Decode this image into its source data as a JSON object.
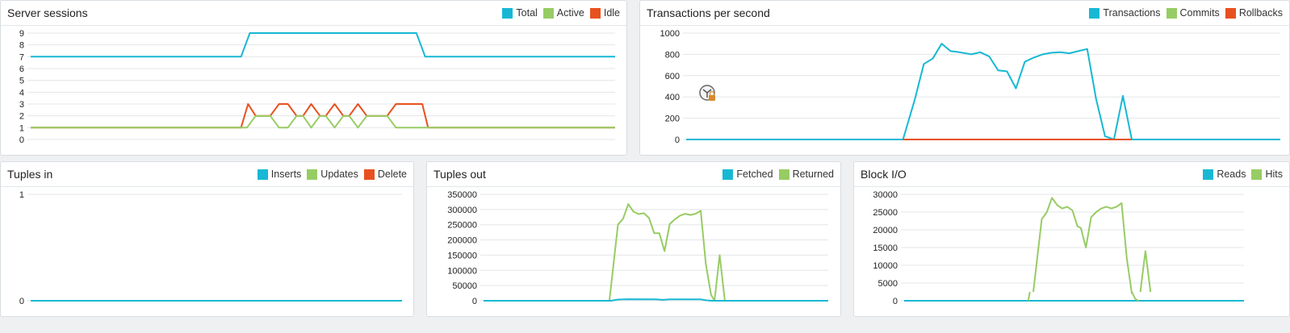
{
  "colors": {
    "cyan": "#17b8d4",
    "green": "#97cc64",
    "red": "#e8501f"
  },
  "chart_data": [
    {
      "id": "sessions",
      "type": "line",
      "title": "Server sessions",
      "yticks": [
        0,
        1,
        2,
        3,
        4,
        5,
        6,
        7,
        8,
        9
      ],
      "ylim": [
        0,
        9
      ],
      "legend": [
        {
          "name": "Total",
          "color": "#17b8d4"
        },
        {
          "name": "Active",
          "color": "#97cc64"
        },
        {
          "name": "Idle",
          "color": "#e8501f"
        }
      ],
      "series": [
        {
          "name": "Total",
          "color": "#17b8d4",
          "points": [
            [
              0,
              7
            ],
            [
              36,
              7
            ],
            [
              37.5,
              9
            ],
            [
              66,
              9
            ],
            [
              67.5,
              7
            ],
            [
              100,
              7
            ]
          ]
        },
        {
          "name": "Idle",
          "color": "#e8501f",
          "points": [
            [
              0,
              1
            ],
            [
              36,
              1
            ],
            [
              37.2,
              3
            ],
            [
              38.5,
              2
            ],
            [
              41,
              2
            ],
            [
              42.5,
              3
            ],
            [
              44,
              3
            ],
            [
              45.5,
              2
            ],
            [
              46.6,
              2
            ],
            [
              48,
              3
            ],
            [
              49.5,
              2
            ],
            [
              50.5,
              2
            ],
            [
              52,
              3
            ],
            [
              53.5,
              2
            ],
            [
              54.5,
              2
            ],
            [
              56,
              3
            ],
            [
              57.5,
              2
            ],
            [
              61,
              2
            ],
            [
              62.5,
              3
            ],
            [
              67,
              3
            ],
            [
              68,
              1
            ],
            [
              100,
              1
            ]
          ]
        },
        {
          "name": "Active",
          "color": "#97cc64",
          "points": [
            [
              0,
              1
            ],
            [
              37,
              1
            ],
            [
              38.5,
              2
            ],
            [
              41,
              2
            ],
            [
              42.5,
              1
            ],
            [
              44,
              1
            ],
            [
              45.5,
              2
            ],
            [
              46.6,
              2
            ],
            [
              48,
              1
            ],
            [
              49.5,
              2
            ],
            [
              50.5,
              2
            ],
            [
              52,
              1
            ],
            [
              53.5,
              2
            ],
            [
              54.5,
              2
            ],
            [
              56,
              1
            ],
            [
              57.5,
              2
            ],
            [
              61,
              2
            ],
            [
              62.5,
              1
            ],
            [
              100,
              1
            ]
          ]
        }
      ]
    },
    {
      "id": "tps",
      "type": "line",
      "title": "Transactions per second",
      "yticks": [
        0,
        200,
        400,
        600,
        800,
        1000
      ],
      "ylim": [
        0,
        1000
      ],
      "legend": [
        {
          "name": "Transactions",
          "color": "#17b8d4"
        },
        {
          "name": "Commits",
          "color": "#97cc64"
        },
        {
          "name": "Rollbacks",
          "color": "#e8501f"
        }
      ],
      "series": [
        {
          "name": "Commits",
          "color": "#97cc64",
          "points": [
            [
              0,
              0
            ],
            [
              100,
              0
            ]
          ]
        },
        {
          "name": "Transactions",
          "color": "#17b8d4",
          "points": [
            [
              0,
              0
            ],
            [
              36.5,
              0
            ],
            [
              38.5,
              380
            ],
            [
              40,
              710
            ],
            [
              41.5,
              760
            ],
            [
              43,
              900
            ],
            [
              44.5,
              830
            ],
            [
              46,
              820
            ],
            [
              48,
              800
            ],
            [
              49.5,
              820
            ],
            [
              51,
              780
            ],
            [
              52.5,
              650
            ],
            [
              54,
              640
            ],
            [
              55.5,
              480
            ],
            [
              57,
              730
            ],
            [
              58.5,
              770
            ],
            [
              60,
              800
            ],
            [
              61.5,
              815
            ],
            [
              63,
              820
            ],
            [
              64.5,
              810
            ],
            [
              66,
              830
            ],
            [
              67.5,
              850
            ],
            [
              69,
              380
            ],
            [
              70.5,
              30
            ],
            [
              72,
              0
            ],
            [
              73.5,
              410
            ],
            [
              75,
              0
            ],
            [
              100,
              0
            ]
          ]
        },
        {
          "name": "Rollbacks",
          "color": "#e8501f",
          "points": [
            [
              36.5,
              0
            ],
            [
              75,
              0
            ]
          ]
        }
      ]
    },
    {
      "id": "tuples_in",
      "type": "line",
      "title": "Tuples in",
      "yticks": [
        0,
        1
      ],
      "ylim": [
        0,
        1
      ],
      "legend": [
        {
          "name": "Inserts",
          "color": "#17b8d4"
        },
        {
          "name": "Updates",
          "color": "#97cc64"
        },
        {
          "name": "Delete",
          "color": "#e8501f"
        }
      ],
      "series": [
        {
          "name": "Inserts",
          "color": "#17b8d4",
          "points": [
            [
              0,
              0
            ],
            [
              100,
              0
            ]
          ]
        }
      ]
    },
    {
      "id": "tuples_out",
      "type": "line",
      "title": "Tuples out",
      "yticks": [
        0,
        50000,
        100000,
        150000,
        200000,
        250000,
        300000,
        350000
      ],
      "ylim": [
        0,
        350000
      ],
      "legend": [
        {
          "name": "Fetched",
          "color": "#17b8d4"
        },
        {
          "name": "Returned",
          "color": "#97cc64"
        }
      ],
      "series": [
        {
          "name": "Returned",
          "color": "#97cc64",
          "points": [
            [
              36.5,
              0
            ],
            [
              39,
              250000
            ],
            [
              40.5,
              270000
            ],
            [
              42,
              318000
            ],
            [
              43.5,
              293000
            ],
            [
              45,
              285000
            ],
            [
              46.5,
              288000
            ],
            [
              48,
              272000
            ],
            [
              49.5,
              222000
            ],
            [
              51,
              222000
            ],
            [
              52.5,
              163000
            ],
            [
              54,
              252000
            ],
            [
              55.5,
              268000
            ],
            [
              57,
              280000
            ],
            [
              58.5,
              286000
            ],
            [
              60,
              282000
            ],
            [
              61.5,
              286000
            ],
            [
              63,
              296000
            ],
            [
              64.5,
              120000
            ],
            [
              66,
              20000
            ],
            [
              67,
              0
            ],
            [
              68.5,
              150000
            ],
            [
              70,
              0
            ]
          ]
        },
        {
          "name": "Fetched",
          "color": "#17b8d4",
          "points": [
            [
              0,
              0
            ],
            [
              37,
              0
            ],
            [
              39,
              4000
            ],
            [
              42,
              5000
            ],
            [
              50,
              4500
            ],
            [
              52,
              3000
            ],
            [
              54,
              4500
            ],
            [
              63,
              4500
            ],
            [
              64.5,
              1500
            ],
            [
              66,
              0
            ],
            [
              100,
              0
            ]
          ]
        }
      ]
    },
    {
      "id": "block_io",
      "type": "line",
      "title": "Block I/O",
      "yticks": [
        0,
        5000,
        10000,
        15000,
        20000,
        25000,
        30000
      ],
      "ylim": [
        0,
        30000
      ],
      "legend": [
        {
          "name": "Reads",
          "color": "#17b8d4"
        },
        {
          "name": "Hits",
          "color": "#97cc64"
        }
      ],
      "series": [
        {
          "name": "Reads",
          "color": "#17b8d4",
          "points": [
            [
              0,
              0
            ],
            [
              100,
              0
            ]
          ]
        },
        {
          "name": "Hits",
          "color": "#97cc64",
          "segments": [
            [
              [
                36.5,
                0
              ],
              [
                37,
                2500
              ]
            ],
            [
              [
                38,
                2500
              ],
              [
                40.5,
                23000
              ],
              [
                42,
                25000
              ],
              [
                43.5,
                29000
              ],
              [
                45,
                27000
              ],
              [
                46.5,
                26000
              ],
              [
                48,
                26500
              ],
              [
                49.5,
                25500
              ],
              [
                51,
                21000
              ],
              [
                52,
                20500
              ],
              [
                53.5,
                15000
              ],
              [
                55,
                23500
              ],
              [
                56.5,
                25000
              ],
              [
                58,
                26000
              ],
              [
                59.5,
                26500
              ],
              [
                61,
                26000
              ],
              [
                62.5,
                26500
              ],
              [
                64,
                27500
              ],
              [
                65.5,
                12000
              ],
              [
                67,
                2000
              ]
            ],
            [
              [
                67,
                2500
              ],
              [
                68,
                500
              ],
              [
                69,
                0
              ]
            ],
            [
              [
                69.5,
                2500
              ],
              [
                71,
                14000
              ],
              [
                72.5,
                2500
              ]
            ]
          ]
        }
      ]
    }
  ]
}
